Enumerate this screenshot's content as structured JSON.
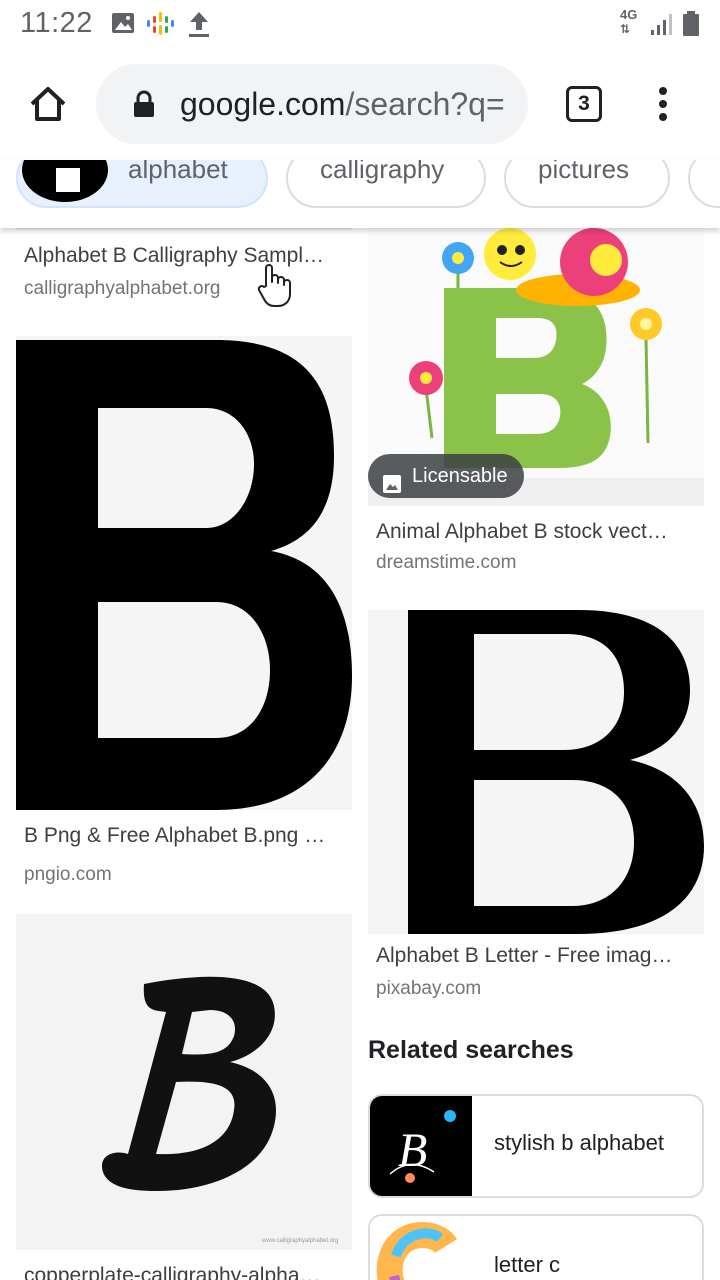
{
  "status_bar": {
    "time": "11:22",
    "network": "4G"
  },
  "browser": {
    "url_domain": "google.com",
    "url_path": "/search?q=",
    "tab_count": "3"
  },
  "chips": [
    {
      "label": "alphabet"
    },
    {
      "label": "calligraphy"
    },
    {
      "label": "pictures"
    }
  ],
  "results": [
    {
      "title": "Alphabet B Calligraphy Sampl…",
      "source": "calligraphyalphabet.org"
    },
    {
      "title": "Animal Alphabet B stock vect…",
      "source": "dreamstime.com",
      "badge": "Licensable"
    },
    {
      "title": "B Png & Free Alphabet B.png …",
      "source": "pngio.com"
    },
    {
      "title": "Alphabet B Letter - Free imag…",
      "source": "pixabay.com"
    },
    {
      "title": "copperplate-calligraphy-alpha…",
      "source": ""
    }
  ],
  "related": {
    "heading": "Related searches",
    "items": [
      {
        "label": "stylish b alphabet"
      },
      {
        "label": "letter c"
      }
    ]
  }
}
